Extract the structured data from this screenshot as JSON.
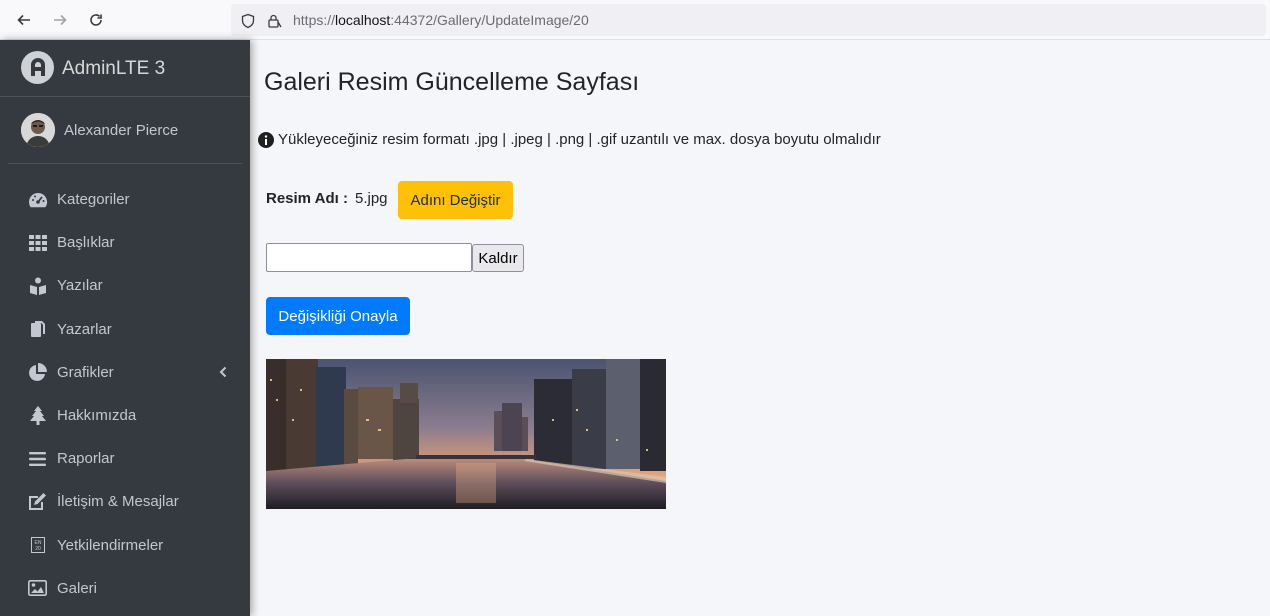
{
  "browser": {
    "url_prefix": "https://",
    "url_host": "localhost",
    "url_path": ":44372/Gallery/UpdateImage/20",
    "back_icon": "arrow-left-icon",
    "forward_icon": "arrow-right-icon",
    "reload_icon": "reload-icon"
  },
  "brand": {
    "text": "AdminLTE 3"
  },
  "user": {
    "name": "Alexander Pierce"
  },
  "sidebar": {
    "items": [
      {
        "label": "Kategoriler",
        "icon": "tachometer-icon"
      },
      {
        "label": "Başlıklar",
        "icon": "grid-icon"
      },
      {
        "label": "Yazılar",
        "icon": "book-reader-icon"
      },
      {
        "label": "Yazarlar",
        "icon": "copy-icon"
      },
      {
        "label": "Grafikler",
        "icon": "pie-chart-icon"
      },
      {
        "label": "Hakkımızda",
        "icon": "tree-icon"
      },
      {
        "label": "Raporlar",
        "icon": "list-icon"
      },
      {
        "label": "İletişim & Mesajlar",
        "icon": "edit-icon"
      },
      {
        "label": "Yetkilendirmeler",
        "icon": "language-icon"
      },
      {
        "label": "Galeri",
        "icon": "image-icon"
      }
    ]
  },
  "main": {
    "title": "Galeri Resim Güncelleme Sayfası",
    "info_text": "Yükleyeceğiniz resim formatı .jpg | .jpeg | .png | .gif uzantılı ve max. dosya boyutu olmalıdır",
    "image_name_label": "Resim Adı :",
    "image_name_value": "5.jpg",
    "rename_button": "Adını Değiştir",
    "file_input_value": "",
    "remove_button": "Kaldır",
    "confirm_button": "Değişikliği Onayla"
  },
  "colors": {
    "warning": "#ffc107",
    "primary": "#007bff",
    "sidebar": "#343a40"
  }
}
